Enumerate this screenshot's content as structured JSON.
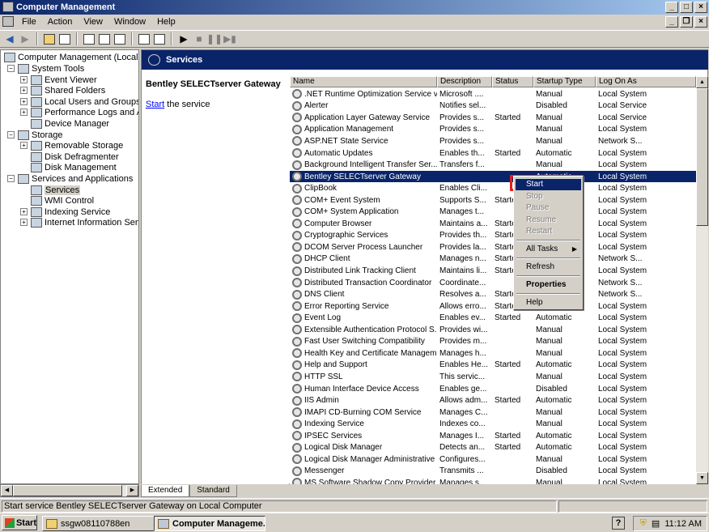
{
  "window": {
    "title": "Computer Management"
  },
  "menu": [
    "File",
    "Action",
    "View",
    "Window",
    "Help"
  ],
  "tree": [
    {
      "label": "Computer Management (Local)",
      "level": 0,
      "expander": ""
    },
    {
      "label": "System Tools",
      "level": 1,
      "expander": "−"
    },
    {
      "label": "Event Viewer",
      "level": 2,
      "expander": "+"
    },
    {
      "label": "Shared Folders",
      "level": 2,
      "expander": "+"
    },
    {
      "label": "Local Users and Groups",
      "level": 2,
      "expander": "+"
    },
    {
      "label": "Performance Logs and Alerts",
      "level": 2,
      "expander": "+"
    },
    {
      "label": "Device Manager",
      "level": 2,
      "expander": ""
    },
    {
      "label": "Storage",
      "level": 1,
      "expander": "−"
    },
    {
      "label": "Removable Storage",
      "level": 2,
      "expander": "+"
    },
    {
      "label": "Disk Defragmenter",
      "level": 2,
      "expander": ""
    },
    {
      "label": "Disk Management",
      "level": 2,
      "expander": ""
    },
    {
      "label": "Services and Applications",
      "level": 1,
      "expander": "−"
    },
    {
      "label": "Services",
      "level": 2,
      "expander": "",
      "selected": true
    },
    {
      "label": "WMI Control",
      "level": 2,
      "expander": ""
    },
    {
      "label": "Indexing Service",
      "level": 2,
      "expander": "+"
    },
    {
      "label": "Internet Information Services",
      "level": 2,
      "expander": "+"
    }
  ],
  "panel": {
    "header": "Services",
    "desc_title": "Bentley SELECTserver Gateway",
    "start_link": "Start",
    "start_suffix": " the service"
  },
  "columns": [
    "Name",
    "Description",
    "Status",
    "Startup Type",
    "Log On As"
  ],
  "services": [
    [
      ".NET Runtime Optimization Service v...",
      "Microsoft ....",
      "",
      "Manual",
      "Local System"
    ],
    [
      "Alerter",
      "Notifies sel...",
      "",
      "Disabled",
      "Local Service"
    ],
    [
      "Application Layer Gateway Service",
      "Provides s...",
      "Started",
      "Manual",
      "Local Service"
    ],
    [
      "Application Management",
      "Provides s...",
      "",
      "Manual",
      "Local System"
    ],
    [
      "ASP.NET State Service",
      "Provides s...",
      "",
      "Manual",
      "Network S..."
    ],
    [
      "Automatic Updates",
      "Enables th...",
      "Started",
      "Automatic",
      "Local System"
    ],
    [
      "Background Intelligent Transfer Ser...",
      "Transfers f...",
      "",
      "Manual",
      "Local System"
    ],
    [
      "Bentley SELECTserver Gateway",
      "",
      "",
      "Automatic",
      "Local System"
    ],
    [
      "ClipBook",
      "Enables Cli...",
      "",
      "",
      "Local System"
    ],
    [
      "COM+ Event System",
      "Supports S...",
      "Starte",
      "",
      "Local System"
    ],
    [
      "COM+ System Application",
      "Manages t...",
      "",
      "",
      "Local System"
    ],
    [
      "Computer Browser",
      "Maintains a...",
      "Starte",
      "",
      "Local System"
    ],
    [
      "Cryptographic Services",
      "Provides th...",
      "Starte",
      "",
      "Local System"
    ],
    [
      "DCOM Server Process Launcher",
      "Provides la...",
      "Starte",
      "",
      "Local System"
    ],
    [
      "DHCP Client",
      "Manages n...",
      "Starte",
      "",
      "Network S..."
    ],
    [
      "Distributed Link Tracking Client",
      "Maintains li...",
      "Starte",
      "",
      "Local System"
    ],
    [
      "Distributed Transaction Coordinator",
      "Coordinate...",
      "",
      "",
      "Network S..."
    ],
    [
      "DNS Client",
      "Resolves a...",
      "Starte",
      "",
      "Network S..."
    ],
    [
      "Error Reporting Service",
      "Allows erro...",
      "Starte",
      "",
      "Local System"
    ],
    [
      "Event Log",
      "Enables ev...",
      "Started",
      "Automatic",
      "Local System"
    ],
    [
      "Extensible Authentication Protocol S...",
      "Provides wi...",
      "",
      "Manual",
      "Local System"
    ],
    [
      "Fast User Switching Compatibility",
      "Provides m...",
      "",
      "Manual",
      "Local System"
    ],
    [
      "Health Key and Certificate Managem...",
      "Manages h...",
      "",
      "Manual",
      "Local System"
    ],
    [
      "Help and Support",
      "Enables He...",
      "Started",
      "Automatic",
      "Local System"
    ],
    [
      "HTTP SSL",
      "This servic...",
      "",
      "Manual",
      "Local System"
    ],
    [
      "Human Interface Device Access",
      "Enables ge...",
      "",
      "Disabled",
      "Local System"
    ],
    [
      "IIS Admin",
      "Allows adm...",
      "Started",
      "Automatic",
      "Local System"
    ],
    [
      "IMAPI CD-Burning COM Service",
      "Manages C...",
      "",
      "Manual",
      "Local System"
    ],
    [
      "Indexing Service",
      "Indexes co...",
      "",
      "Manual",
      "Local System"
    ],
    [
      "IPSEC Services",
      "Manages I...",
      "Started",
      "Automatic",
      "Local System"
    ],
    [
      "Logical Disk Manager",
      "Detects an...",
      "Started",
      "Automatic",
      "Local System"
    ],
    [
      "Logical Disk Manager Administrative ...",
      "Configures...",
      "",
      "Manual",
      "Local System"
    ],
    [
      "Messenger",
      "Transmits ...",
      "",
      "Disabled",
      "Local System"
    ],
    [
      "MS Software Shadow Copy Provider",
      "Manages s...",
      "",
      "Manual",
      "Local System"
    ]
  ],
  "context_menu": {
    "start": "Start",
    "stop": "Stop",
    "pause": "Pause",
    "resume": "Resume",
    "restart": "Restart",
    "all_tasks": "All Tasks",
    "refresh": "Refresh",
    "properties": "Properties",
    "help": "Help"
  },
  "tabs": [
    "Extended",
    "Standard"
  ],
  "status": "Start service Bentley SELECTserver Gateway on Local Computer",
  "taskbar": {
    "start": "Start",
    "task1": "ssgw08110788en",
    "task2": "Computer Manageme...",
    "clock": "11:12 AM",
    "help": "?"
  },
  "colors": {
    "title_blue": "#0a246a",
    "highlight_red": "#e02020"
  }
}
